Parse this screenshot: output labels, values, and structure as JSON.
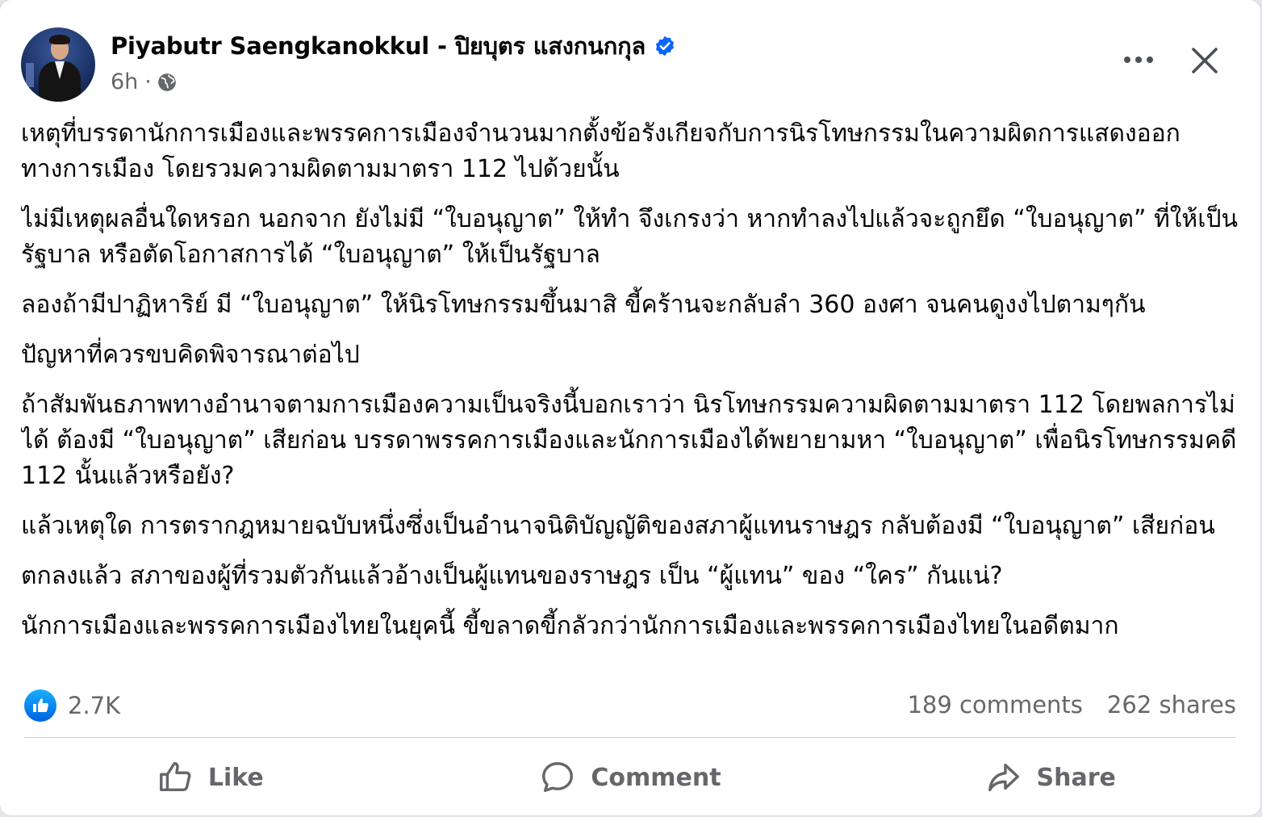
{
  "post": {
    "author": "Piyabutr Saengkanokkul - ปิยบุตร แสงกนกกุล",
    "time": "6h",
    "separator": "·",
    "paragraphs": [
      "เหตุที่บรรดานักการเมืองและพรรคการเมืองจำนวนมากตั้งข้อรังเกียจกับการนิรโทษกรรมในความผิดการแสดงออกทางการเมือง โดยรวมความผิดตามมาตรา 112 ไปด้วยนั้น",
      "ไม่มีเหตุผลอื่นใดหรอก นอกจาก ยังไม่มี “ใบอนุญาต” ให้ทำ จึงเกรงว่า หากทำลงไปแล้วจะถูกยึด “ใบอนุญาต” ที่ให้เป็นรัฐบาล หรือตัดโอกาสการได้ “ใบอนุญาต” ให้เป็นรัฐบาล",
      "ลองถ้ามีปาฏิหาริย์ มี “ใบอนุญาต” ให้นิรโทษกรรมขึ้นมาสิ ขี้คร้านจะกลับลำ 360 องศา จนคนดูงงไปตามๆกัน",
      "ปัญหาที่ควรขบคิดพิจารณาต่อไป",
      "ถ้าสัมพันธภาพทางอำนาจตามการเมืองความเป็นจริงนี้บอกเราว่า นิรโทษกรรมความผิดตามมาตรา 112 โดยพลการไม่ได้ ต้องมี “ใบอนุญาต” เสียก่อน บรรดาพรรคการเมืองและนักการเมืองได้พยายามหา “ใบอนุญาต” เพื่อนิรโทษกรรมคดี 112 นั้นแล้วหรือยัง?",
      "แล้วเหตุใด การตรากฎหมายฉบับหนึ่งซึ่งเป็นอำนาจนิติบัญญัติของสภาผู้แทนราษฎร กลับต้องมี “ใบอนุญาต” เสียก่อน",
      "ตกลงแล้ว สภาของผู้ที่รวมตัวกันแล้วอ้างเป็นผู้แทนของราษฎร เป็น “ผู้แทน” ของ “ใคร” กันแน่?",
      "นักการเมืองและพรรคการเมืองไทยในยุคนี้ ขี้ขลาดขี้กลัวกว่านักการเมืองและพรรคการเมืองไทยในอดีตมาก"
    ]
  },
  "stats": {
    "reactions": "2.7K",
    "comments": "189 comments",
    "shares": "262 shares"
  },
  "actions": {
    "like": "Like",
    "comment": "Comment",
    "share": "Share"
  },
  "colors": {
    "accent": "#0866ff",
    "secondary_text": "#65676b",
    "divider": "#ced0d4"
  },
  "icons": {
    "verified": "verified-badge-icon",
    "audience": "globe-icon",
    "more": "more-horizontal-icon",
    "close": "close-icon",
    "reaction": "like-reaction-icon",
    "like": "thumbs-up-icon",
    "comment": "comment-bubble-icon",
    "share": "share-arrow-icon"
  }
}
